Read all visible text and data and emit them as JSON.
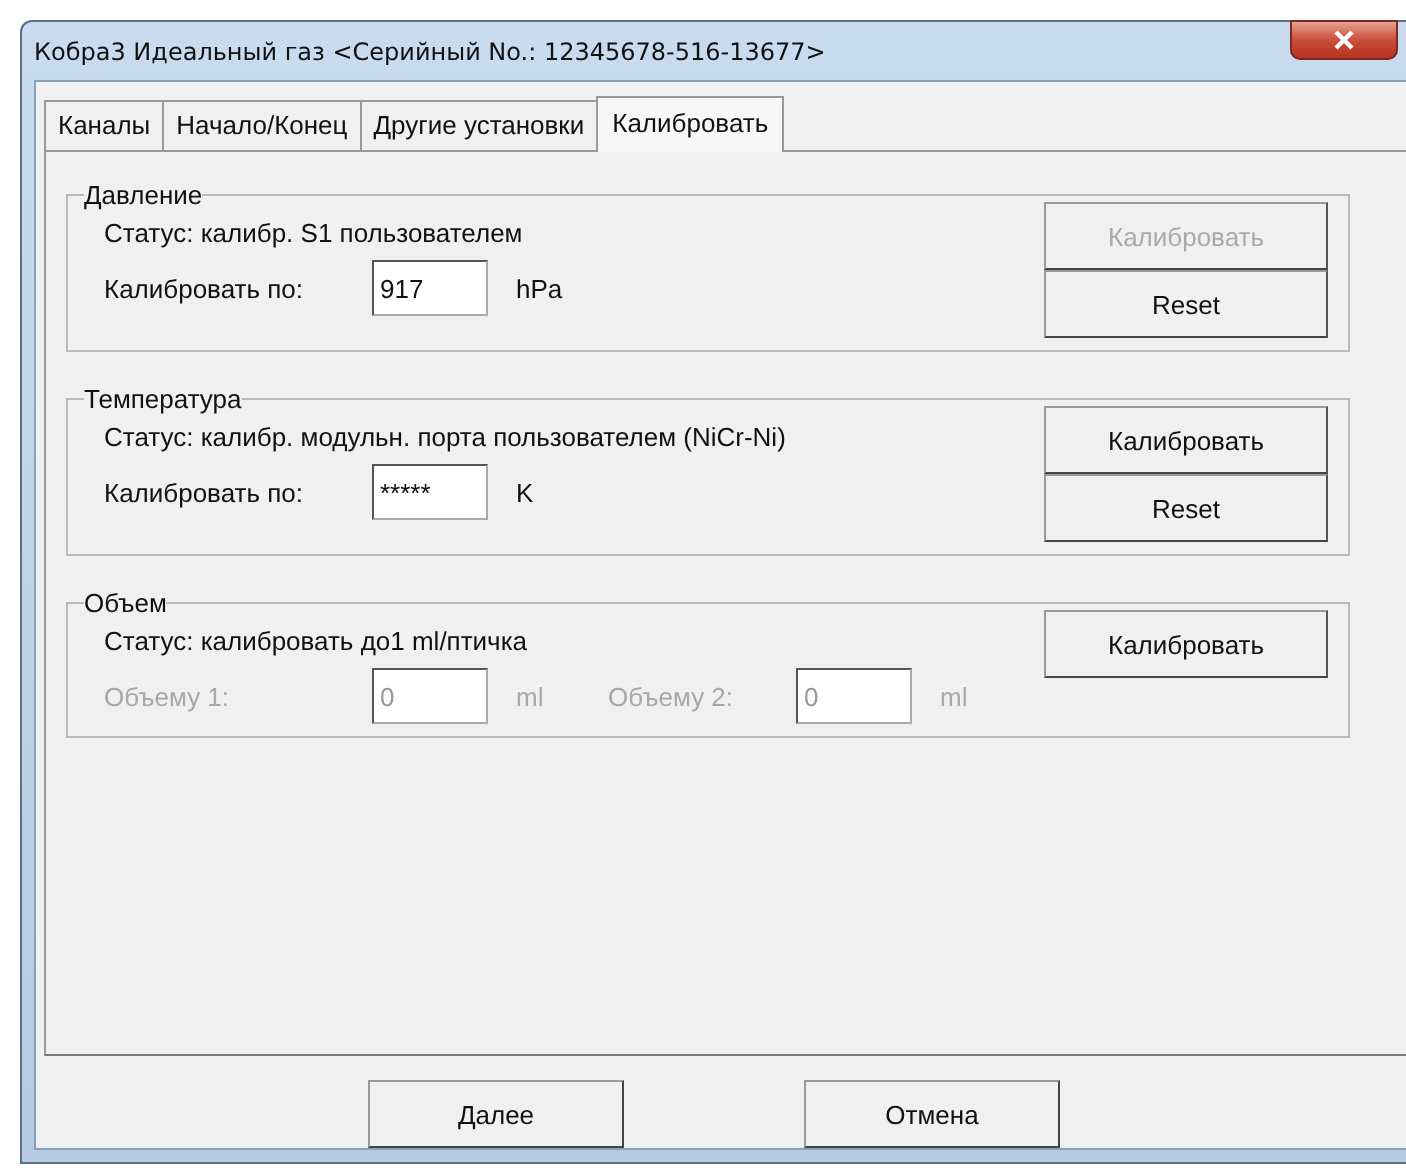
{
  "window": {
    "title": "Кобра3 Идеальный газ  <Серийный No.: 12345678-516-13677>"
  },
  "tabs": [
    {
      "label": "Каналы",
      "selected": false
    },
    {
      "label": "Начало/Конец",
      "selected": false
    },
    {
      "label": "Другие установки",
      "selected": false
    },
    {
      "label": "Калибровать",
      "selected": true
    }
  ],
  "groups": [
    {
      "kind": "point",
      "title": "Давление",
      "status": "Статус:  калибр. S1 пользователем",
      "input_label": "Калибровать по:",
      "value": "917",
      "unit": "hPa",
      "buttons": [
        {
          "label": "Калибровать",
          "disabled": true
        },
        {
          "label": "Reset",
          "disabled": false
        }
      ]
    },
    {
      "kind": "point",
      "title": "Температура",
      "status": "Статус:  калибр. модульн. порта пользователем (NiCr-Ni)",
      "input_label": "Калибровать по:",
      "value": "*****",
      "unit": "K",
      "buttons": [
        {
          "label": "Калибровать",
          "disabled": false
        },
        {
          "label": "Reset",
          "disabled": false
        }
      ]
    },
    {
      "kind": "volume",
      "title": "Объем",
      "status": "Статус:  калибровать до1 ml/птичка",
      "fields": [
        {
          "label": "Объему 1:",
          "value": "0",
          "unit": "ml",
          "disabled": true
        },
        {
          "label": "Объему 2:",
          "value": "0",
          "unit": "ml",
          "disabled": true
        }
      ],
      "buttons": [
        {
          "label": "Калибровать",
          "disabled": false
        }
      ]
    }
  ],
  "footer_buttons": [
    "Далее",
    "Отмена"
  ]
}
